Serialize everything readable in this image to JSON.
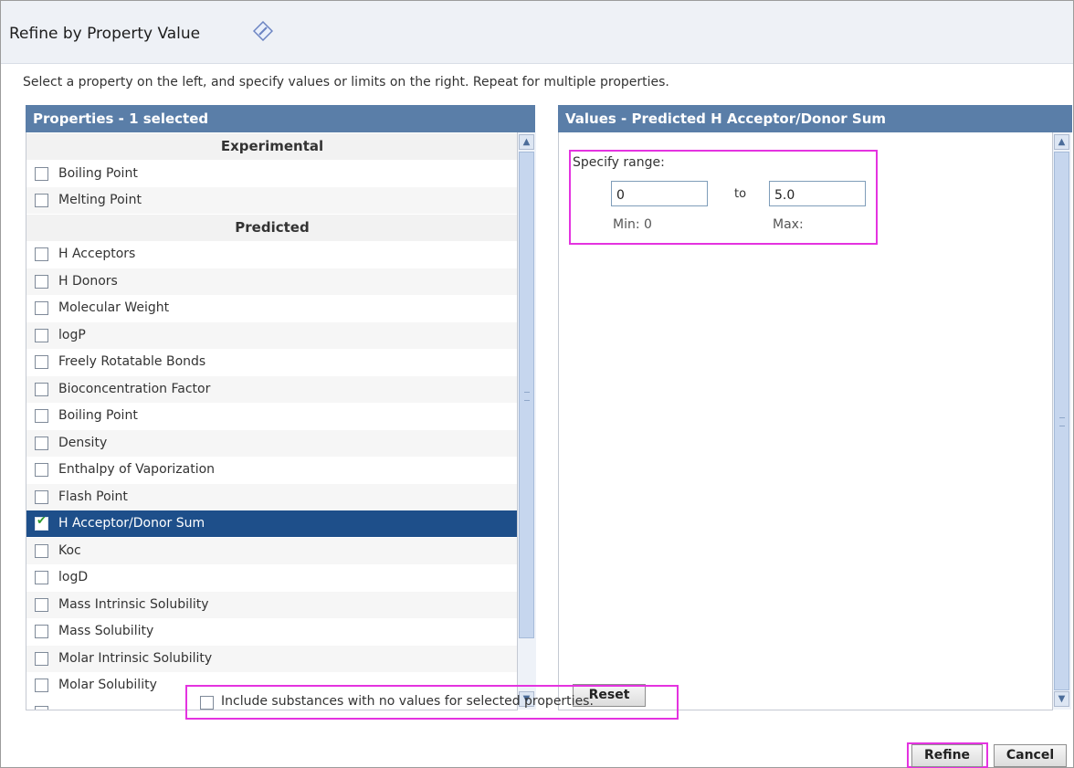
{
  "dialog": {
    "title": "Refine by Property Value",
    "help_icon": "help-diamond-icon",
    "instructions": "Select a property on the left, and specify values or limits on the right. Repeat for multiple properties."
  },
  "properties": {
    "header": "Properties -  1 selected",
    "rows": [
      {
        "kind": "group",
        "label": "Experimental"
      },
      {
        "kind": "item",
        "label": "Boiling Point",
        "checked": false
      },
      {
        "kind": "item",
        "label": "Melting Point",
        "checked": false
      },
      {
        "kind": "group",
        "label": "Predicted"
      },
      {
        "kind": "item",
        "label": "H Acceptors",
        "checked": false
      },
      {
        "kind": "item",
        "label": "H Donors",
        "checked": false
      },
      {
        "kind": "item",
        "label": "Molecular Weight",
        "checked": false
      },
      {
        "kind": "item",
        "label": "logP",
        "checked": false
      },
      {
        "kind": "item",
        "label": "Freely Rotatable Bonds",
        "checked": false
      },
      {
        "kind": "item",
        "label": "Bioconcentration Factor",
        "checked": false
      },
      {
        "kind": "item",
        "label": "Boiling Point",
        "checked": false
      },
      {
        "kind": "item",
        "label": "Density",
        "checked": false
      },
      {
        "kind": "item",
        "label": "Enthalpy of Vaporization",
        "checked": false
      },
      {
        "kind": "item",
        "label": "Flash Point",
        "checked": false
      },
      {
        "kind": "item",
        "label": "H Acceptor/Donor Sum",
        "checked": true,
        "selected": true
      },
      {
        "kind": "item",
        "label": "Koc",
        "checked": false
      },
      {
        "kind": "item",
        "label": "logD",
        "checked": false
      },
      {
        "kind": "item",
        "label": "Mass Intrinsic Solubility",
        "checked": false
      },
      {
        "kind": "item",
        "label": "Mass Solubility",
        "checked": false
      },
      {
        "kind": "item",
        "label": "Molar Intrinsic Solubility",
        "checked": false
      },
      {
        "kind": "item",
        "label": "Molar Solubility",
        "checked": false
      }
    ]
  },
  "values": {
    "header": "Values - Predicted H Acceptor/Donor Sum",
    "range_title": "Specify range:",
    "min_value": "0",
    "max_value": "5.0",
    "to_label": "to",
    "min_label": "Min: 0",
    "max_label": "Max:",
    "reset_label": "Reset"
  },
  "footer": {
    "include_label": "Include substances with no values for selected properties.",
    "include_checked": false,
    "refine_label": "Refine",
    "cancel_label": "Cancel"
  },
  "colors": {
    "header_bg": "#5a7ea8",
    "selected_row": "#1e4f8a",
    "highlight": "#e433e0"
  }
}
